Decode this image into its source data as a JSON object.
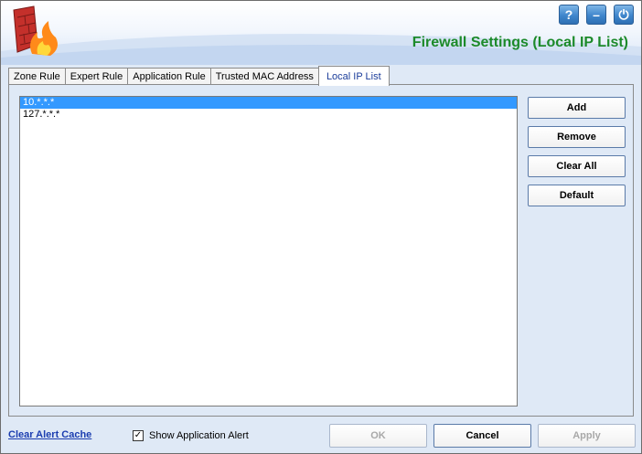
{
  "header": {
    "title": "Firewall Settings (Local IP List)",
    "help_glyph": "?",
    "minimize_glyph": "–",
    "power_glyph": "⏻"
  },
  "tabs": [
    {
      "label": "Zone Rule",
      "active": false
    },
    {
      "label": "Expert Rule",
      "active": false
    },
    {
      "label": "Application Rule",
      "active": false
    },
    {
      "label": "Trusted MAC Address",
      "active": false
    },
    {
      "label": "Local IP List",
      "active": true
    }
  ],
  "ip_list": {
    "items": [
      "10.*.*.*",
      "127.*.*.*"
    ],
    "selected_index": 0
  },
  "side_buttons": {
    "add": "Add",
    "remove": "Remove",
    "clear_all": "Clear All",
    "default": "Default"
  },
  "footer": {
    "clear_cache_link": "Clear Alert Cache",
    "show_alert_label": "Show Application Alert",
    "show_alert_checked": true,
    "check_glyph": "✓",
    "ok": "OK",
    "cancel": "Cancel",
    "apply": "Apply"
  },
  "colors": {
    "title_green": "#1c8a2a",
    "selection_blue": "#3399ff",
    "link_blue": "#1b3db0"
  }
}
